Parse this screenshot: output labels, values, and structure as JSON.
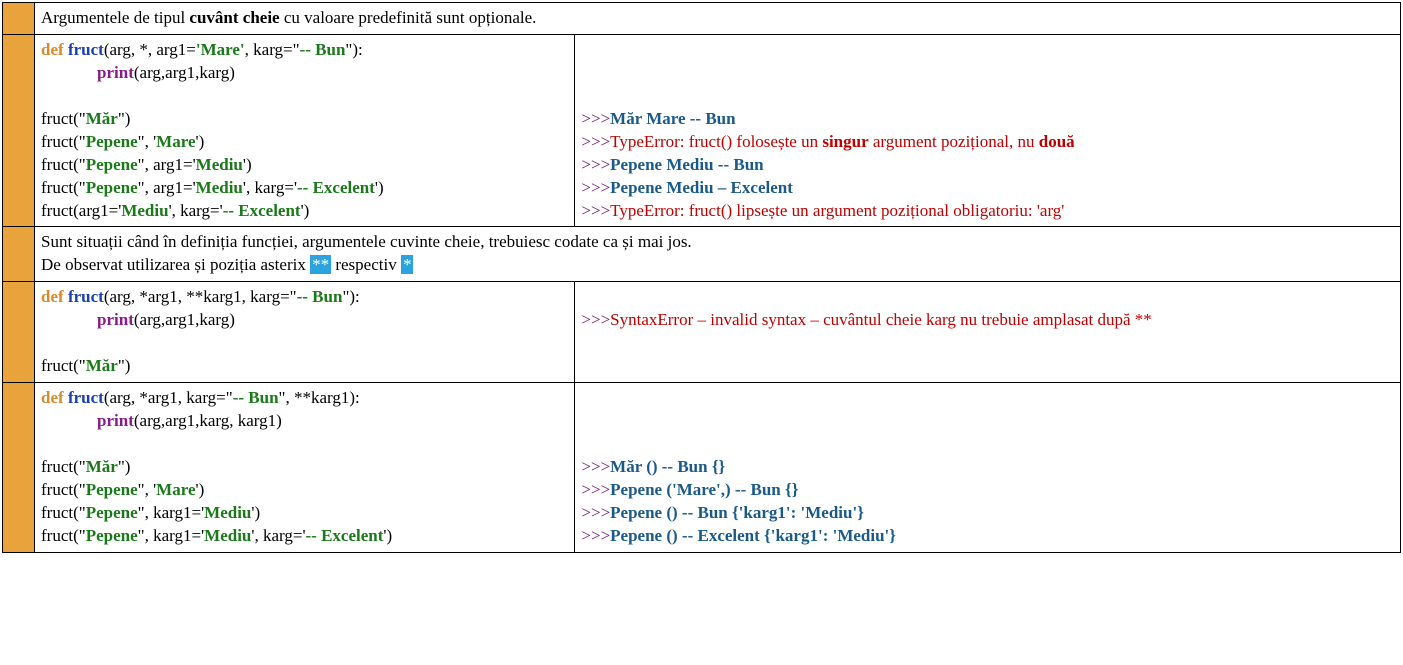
{
  "row1": {
    "text_pre": "Argumentele de tipul ",
    "text_bold": "cuvânt cheie",
    "text_post": " cu valoare predefinită sunt opționale."
  },
  "row2": {
    "def": "def",
    "fname": "fruct",
    "sig_pre": "(arg, *, arg1=",
    "sig_s1": "'Mare'",
    "sig_mid": ", karg=\"",
    "sig_s2": "-- Bun",
    "sig_post": "\"):",
    "print": "print",
    "print_args": "(arg,arg1,karg)",
    "call1_pre": "fruct(\"",
    "call1_s": "Măr",
    "call1_post": "\")",
    "call2_pre": "fruct(\"",
    "call2_s1": "Pepene",
    "call2_mid": "\", '",
    "call2_s2": "Mare",
    "call2_post": "')",
    "call3_pre": "fruct(\"",
    "call3_s1": "Pepene",
    "call3_mid": "\", arg1='",
    "call3_s2": "Mediu",
    "call3_post": "')",
    "call4_pre": "fruct(\"",
    "call4_s1": "Pepene",
    "call4_mid1": "\", arg1='",
    "call4_s2": "Mediu",
    "call4_mid2": "', karg='",
    "call4_s3": "-- Excelent",
    "call4_post": "')",
    "call5_pre": "fruct(arg1='",
    "call5_s1": "Mediu",
    "call5_mid": "', karg='",
    "call5_s2": "-- Excelent",
    "call5_post": "')",
    "out1": "Măr Mare -- Bun",
    "out2_pre": "TypeError:  fruct() folosește un ",
    "out2_b1": "singur",
    "out2_mid": " argument pozițional, nu ",
    "out2_b2": "două",
    "out3": "Pepene Mediu -- Bun",
    "out4": "Pepene Mediu – Excelent",
    "out5": "TypeError: fruct() lipsește un argument pozițional obligatoriu: 'arg'",
    "prompt": ">>>"
  },
  "row3": {
    "line1": "Sunt situații când în definiția funcției, argumentele cuvinte cheie, trebuiesc codate ca și mai jos.",
    "line2_pre": "De observat utilizarea și poziția asterix ",
    "hl1": "**",
    "line2_mid": " respectiv ",
    "hl2": "*"
  },
  "row4": {
    "def": "def",
    "fname": "fruct",
    "sig_pre": "(arg, *arg1, **karg1, karg=\"",
    "sig_s": "-- Bun",
    "sig_post": "\"):",
    "print": "print",
    "print_args": "(arg,arg1,karg)",
    "call1_pre": "fruct(\"",
    "call1_s": "Măr",
    "call1_post": "\")",
    "prompt": ">>>",
    "out": "SyntaxError – invalid syntax – cuvântul cheie karg nu trebuie amplasat  după **"
  },
  "row5": {
    "def": "def",
    "fname": "fruct",
    "sig_pre": "(arg, *arg1, karg=\"",
    "sig_s": "-- Bun",
    "sig_post": "\", **karg1):",
    "print": "print",
    "print_args": "(arg,arg1,karg, karg1)",
    "call1_pre": "fruct(\"",
    "call1_s": "Măr",
    "call1_post": "\")",
    "call2_pre": "fruct(\"",
    "call2_s1": "Pepene",
    "call2_mid": "\", '",
    "call2_s2": "Mare",
    "call2_post": "')",
    "call3_pre": "fruct(\"",
    "call3_s1": "Pepene",
    "call3_mid": "\", karg1='",
    "call3_s2": "Mediu",
    "call3_post": "')",
    "call4_pre": "fruct(\"",
    "call4_s1": "Pepene",
    "call4_mid1": "\", karg1='",
    "call4_s2": "Mediu",
    "call4_mid2": "', karg='",
    "call4_s3": "-- Excelent",
    "call4_post": "')",
    "prompt": ">>>",
    "out1": "Măr () -- Bun {}",
    "out2": "Pepene ('Mare',) -- Bun {}",
    "out3": "Pepene () -- Bun {'karg1': 'Mediu'}",
    "out4": "Pepene () -- Excelent {'karg1': 'Mediu'}"
  }
}
